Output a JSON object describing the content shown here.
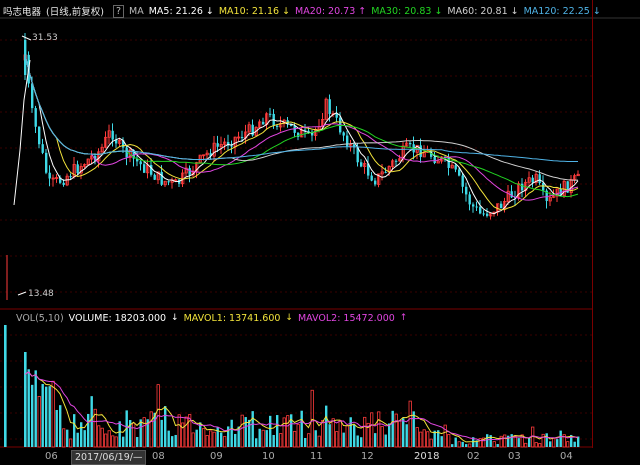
{
  "header": {
    "stock_name": "吗志电器",
    "mode": "(日线,前复权)",
    "help": "?",
    "ma_label": "MA"
  },
  "ma": [
    {
      "label": "MA5: 21.26",
      "arrow": "↓",
      "color": "#ffffff"
    },
    {
      "label": "MA10: 21.16",
      "arrow": "↓",
      "color": "#f2e33b"
    },
    {
      "label": "MA20: 20.73",
      "arrow": "↑",
      "color": "#e046e0"
    },
    {
      "label": "MA30: 20.83",
      "arrow": "↓",
      "color": "#22d422"
    },
    {
      "label": "MA60: 20.81",
      "arrow": "↓",
      "color": "#cfcfcf"
    },
    {
      "label": "MA120: 22.25",
      "arrow": "↓",
      "color": "#4fb3e6"
    }
  ],
  "price": {
    "high_label": "31.53",
    "low_label": "13.48"
  },
  "volume": {
    "title": "VOL(5,10)",
    "volume_label": "VOLUME: 18203.000",
    "volume_arrow": "↓",
    "mavol1_label": "MAVOL1: 13741.600",
    "mavol1_arrow": "↓",
    "mavol2_label": "MAVOL2: 15472.000",
    "mavol2_arrow": "↑"
  },
  "xaxis": {
    "cursor_date": "2017/06/19/—",
    "ticks": [
      "06",
      "08",
      "09",
      "10",
      "11",
      "12",
      "2018",
      "02",
      "03",
      "04"
    ]
  },
  "colors": {
    "up": "#ff3b3b",
    "down": "#3fd9e6",
    "bg": "#000000"
  }
}
